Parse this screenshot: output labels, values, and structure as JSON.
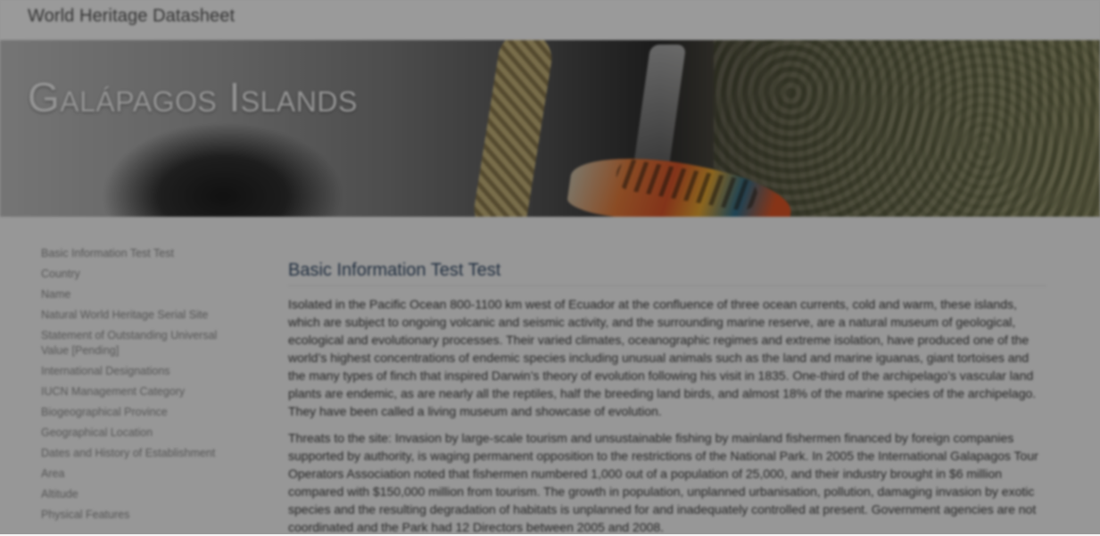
{
  "header": {
    "brand": "World Heritage Datasheet"
  },
  "hero": {
    "title": "Galápagos Islands"
  },
  "sidebar": {
    "items": [
      {
        "label": "Basic Information Test Test"
      },
      {
        "label": "Country"
      },
      {
        "label": "Name"
      },
      {
        "label": "Natural World Heritage Serial Site"
      },
      {
        "label": "Statement of Outstanding Universal Value [Pending]"
      },
      {
        "label": "International Designations"
      },
      {
        "label": "IUCN Management Category"
      },
      {
        "label": "Biogeographical Province"
      },
      {
        "label": "Geographical Location"
      },
      {
        "label": "Dates and History of Establishment"
      },
      {
        "label": "Area"
      },
      {
        "label": "Altitude"
      },
      {
        "label": "Physical Features"
      }
    ]
  },
  "content": {
    "heading": "Basic Information Test Test",
    "paragraphs": [
      "Isolated in the Pacific Ocean 800-1100 km west of Ecuador at the confluence of three ocean currents, cold and warm, these islands, which are subject to ongoing volcanic and seismic activity, and the surrounding marine reserve, are a natural museum of geological, ecological and evolutionary processes. Their varied climates, oceanographic regimes and extreme isolation, have produced one of the world’s highest concentrations of endemic species including unusual animals such as the land and marine iguanas, giant tortoises and the many types of finch that inspired Darwin’s theory of evolution following his visit in 1835. One-third of the archipelago’s vascular land plants are endemic, as are nearly all the reptiles, half the breeding land birds, and almost 18% of the marine species of the archipelago. They have been called a living museum and showcase of evolution.",
      "Threats to the site: Invasion by large-scale tourism and unsustainable fishing by mainland fishermen financed by foreign companies supported by authority, is waging permanent opposition to the restrictions of the National Park. In 2005 the International Galapagos Tour Operators Association noted that fishermen numbered 1,000 out of a population of 25,000, and their industry brought in $6 million compared with $150,000 million from tourism. The growth in population, unplanned urbanisation, pollution, damaging invasion by exotic species and the resulting degradation of habitats is unplanned for and inadequately controlled at present. Government agencies are not coordinated and the Park had 12 Directors between 2005 and 2008."
    ]
  },
  "colors": {
    "heading": "#334a66",
    "overlay": "rgba(0,0,0,0.38)"
  }
}
